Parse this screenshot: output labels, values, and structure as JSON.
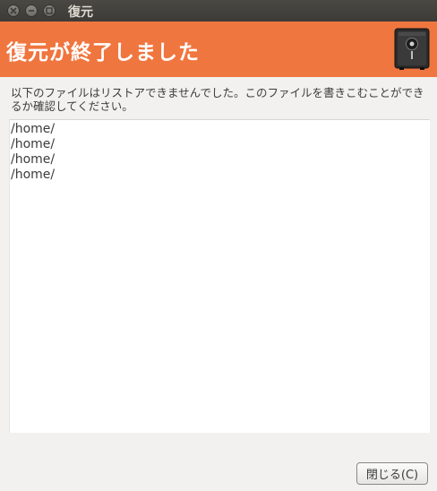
{
  "window": {
    "title": "復元"
  },
  "header": {
    "title": "復元が終了しました",
    "icon": "safe-icon"
  },
  "message": {
    "text": "以下のファイルはリストアできませんでした。このファイルを書きこむことができるか確認してください。"
  },
  "files": [
    "/home/",
    "/home/",
    "/home/",
    "/home/"
  ],
  "buttons": {
    "close_label": "閉じる(C)"
  },
  "colors": {
    "header_bg": "#f0763f",
    "titlebar_bg": "#3c3b37",
    "window_bg": "#f2f1f0"
  }
}
